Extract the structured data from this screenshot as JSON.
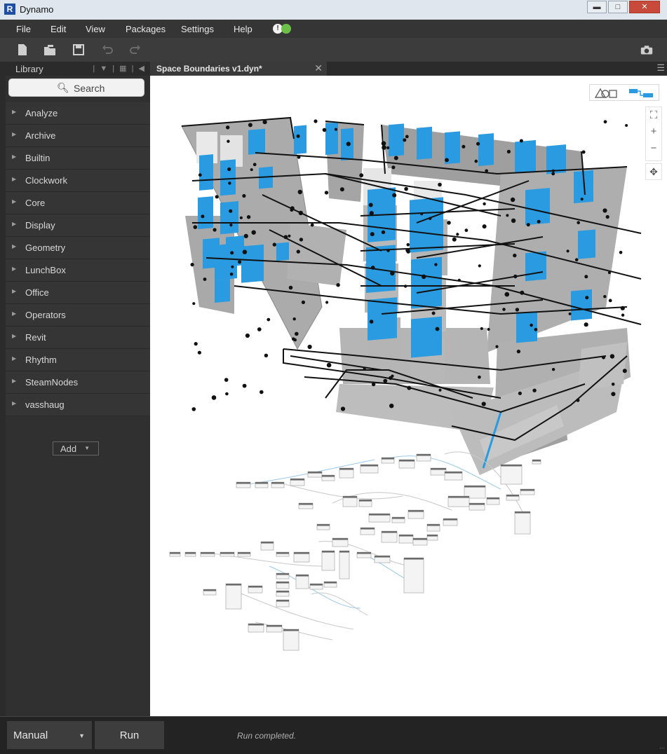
{
  "window": {
    "title": "Dynamo",
    "logo_letter": "R"
  },
  "menu": {
    "items": [
      "File",
      "Edit",
      "View",
      "Packages",
      "Settings",
      "Help"
    ],
    "status_icons": [
      "warning",
      "ok"
    ]
  },
  "toolbar": {
    "icons": [
      "new-file-icon",
      "open-file-icon",
      "save-icon",
      "undo-icon",
      "redo-icon",
      "camera-icon"
    ]
  },
  "library": {
    "header": "Library",
    "search_placeholder": "Search",
    "categories": [
      "Analyze",
      "Archive",
      "Builtin",
      "Clockwork",
      "Core",
      "Display",
      "Geometry",
      "LunchBox",
      "Office",
      "Operators",
      "Revit",
      "Rhythm",
      "SteamNodes",
      "vasshaug"
    ],
    "add_label": "Add"
  },
  "tab": {
    "label": "Space Boundaries v1.dyn*"
  },
  "canvas": {
    "accent_color": "#2a9be0",
    "wall_color": "#a9a9a9"
  },
  "bottom": {
    "run_mode": "Manual",
    "run_label": "Run",
    "status": "Run completed."
  }
}
